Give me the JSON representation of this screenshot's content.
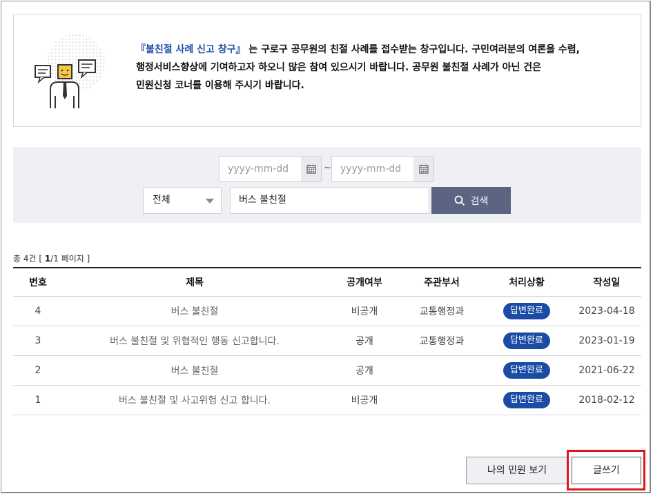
{
  "intro": {
    "highlight": "『불친절 사례 신고 창구』",
    "line1": " 는 구로구 공무원의 친절 사례를 접수받는 창구입니다. 구민여러분의 여론을 수렴,",
    "line2": "행정서비스향상에 기여하고자 하오니 많은 참여 있으시기 바랍니다. 공무원 불친절 사례가 아닌 건은",
    "line3": "민원신청 코너를 이용해 주시기 바랍니다."
  },
  "search": {
    "date_from_placeholder": "yyyy-mm-dd",
    "date_to_placeholder": "yyyy-mm-dd",
    "tilde": "~",
    "category_selected": "전체",
    "keyword_value": "버스 불친절",
    "search_button_label": "검색"
  },
  "summary": {
    "prefix": "총 4건 [ ",
    "current_page": "1",
    "suffix": "/1 페이지 ]"
  },
  "table": {
    "headers": [
      "번호",
      "제목",
      "공개여부",
      "주관부서",
      "처리상황",
      "작성일"
    ],
    "rows": [
      {
        "no": "4",
        "title": "버스 불친절",
        "public": "비공개",
        "dept": "교통행정과",
        "status": "답변완료",
        "date": "2023-04-18"
      },
      {
        "no": "3",
        "title": "버스 불친절 및 위협적인 행동 신고합니다.",
        "public": "공개",
        "dept": "교통행정과",
        "status": "답변완료",
        "date": "2023-01-19"
      },
      {
        "no": "2",
        "title": "버스 불친절",
        "public": "공개",
        "dept": "",
        "status": "답변완료",
        "date": "2021-06-22"
      },
      {
        "no": "1",
        "title": "버스 불친절 및 사고위험 신고 합니다.",
        "public": "비공개",
        "dept": "",
        "status": "답변완료",
        "date": "2018-02-12"
      }
    ]
  },
  "buttons": {
    "my_petitions": "나의 민원 보기",
    "write": "글쓰기"
  },
  "colors": {
    "accent_blue": "#1d4fa8",
    "badge_blue": "#1b4ba4",
    "search_button": "#5b6581",
    "highlight_outline": "#e2131c"
  }
}
